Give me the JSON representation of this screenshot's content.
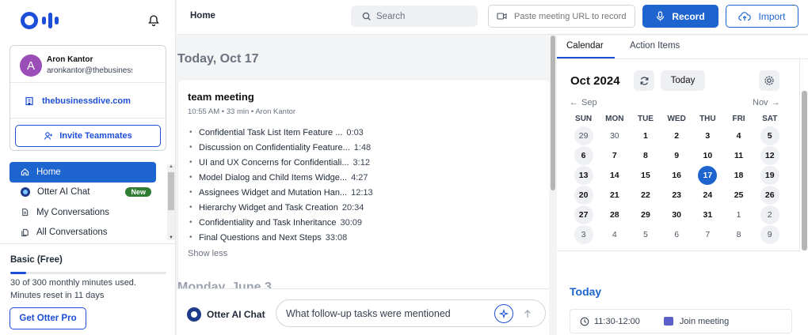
{
  "app": {
    "page_title": "Home",
    "accent": "#1d64cf"
  },
  "user": {
    "initial": "A",
    "name": "Aron Kantor",
    "email": "aronkantor@thebusinessdive.com",
    "domain": "thebusinessdive.com",
    "invite_label": "Invite Teammates"
  },
  "sidebar": {
    "items": [
      {
        "label": "Home",
        "icon": "home-icon",
        "active": true
      },
      {
        "label": "Otter AI Chat",
        "icon": "otter-chat-icon",
        "badge": "New"
      },
      {
        "label": "My Conversations",
        "icon": "document-icon"
      },
      {
        "label": "All Conversations",
        "icon": "documents-icon"
      }
    ]
  },
  "plan": {
    "title": "Basic (Free)",
    "usage": "30 of 300 monthly minutes used.",
    "reset": "Minutes reset in 11 days",
    "usage_fraction": 0.1,
    "cta": "Get Otter Pro"
  },
  "topbar": {
    "search_placeholder": "Search",
    "url_placeholder": "Paste meeting URL to record",
    "record_label": "Record",
    "import_label": "Import"
  },
  "feed": {
    "date_heading": "Today, Oct 17",
    "next_date_heading": "Monday, June 3",
    "meeting": {
      "title": "team meeting",
      "meta": "10:55 AM  •  33 min  •  Aron Kantor",
      "outline": [
        {
          "text": "Confidential Task List Item Feature ...",
          "time": "0:03"
        },
        {
          "text": "Discussion on Confidentiality Feature...",
          "time": "1:48"
        },
        {
          "text": "UI and UX Concerns for Confidentiali...",
          "time": "3:12"
        },
        {
          "text": "Model Dialog and Child Items Widge...",
          "time": "4:27"
        },
        {
          "text": "Assignees Widget and Mutation Han...",
          "time": "12:13"
        },
        {
          "text": "Hierarchy Widget and Task Creation",
          "time": "20:34"
        },
        {
          "text": "Confidentiality and Task Inheritance",
          "time": "30:09"
        },
        {
          "text": "Final Questions and Next Steps",
          "time": "33:08"
        }
      ],
      "show_less": "Show less"
    }
  },
  "chat": {
    "label": "Otter AI Chat",
    "input_value": "What follow-up tasks were mentioned"
  },
  "calendar": {
    "tabs": [
      "Calendar",
      "Action Items"
    ],
    "month_label": "Oct 2024",
    "today_button": "Today",
    "prev_month": "Sep",
    "next_month": "Nov",
    "weekdays": [
      "SUN",
      "MON",
      "TUE",
      "WED",
      "THU",
      "FRI",
      "SAT"
    ],
    "selected_day": "17",
    "weeks": [
      [
        "29",
        "30",
        "1",
        "2",
        "3",
        "4",
        "5"
      ],
      [
        "6",
        "7",
        "8",
        "9",
        "10",
        "11",
        "12"
      ],
      [
        "13",
        "14",
        "15",
        "16",
        "17",
        "18",
        "19"
      ],
      [
        "20",
        "21",
        "22",
        "23",
        "24",
        "25",
        "26"
      ],
      [
        "27",
        "28",
        "29",
        "30",
        "31",
        "1",
        "2"
      ],
      [
        "3",
        "4",
        "5",
        "6",
        "7",
        "8",
        "9"
      ]
    ]
  },
  "today_panel": {
    "title": "Today",
    "event_time": "11:30-12:00",
    "event_action": "Join meeting"
  }
}
